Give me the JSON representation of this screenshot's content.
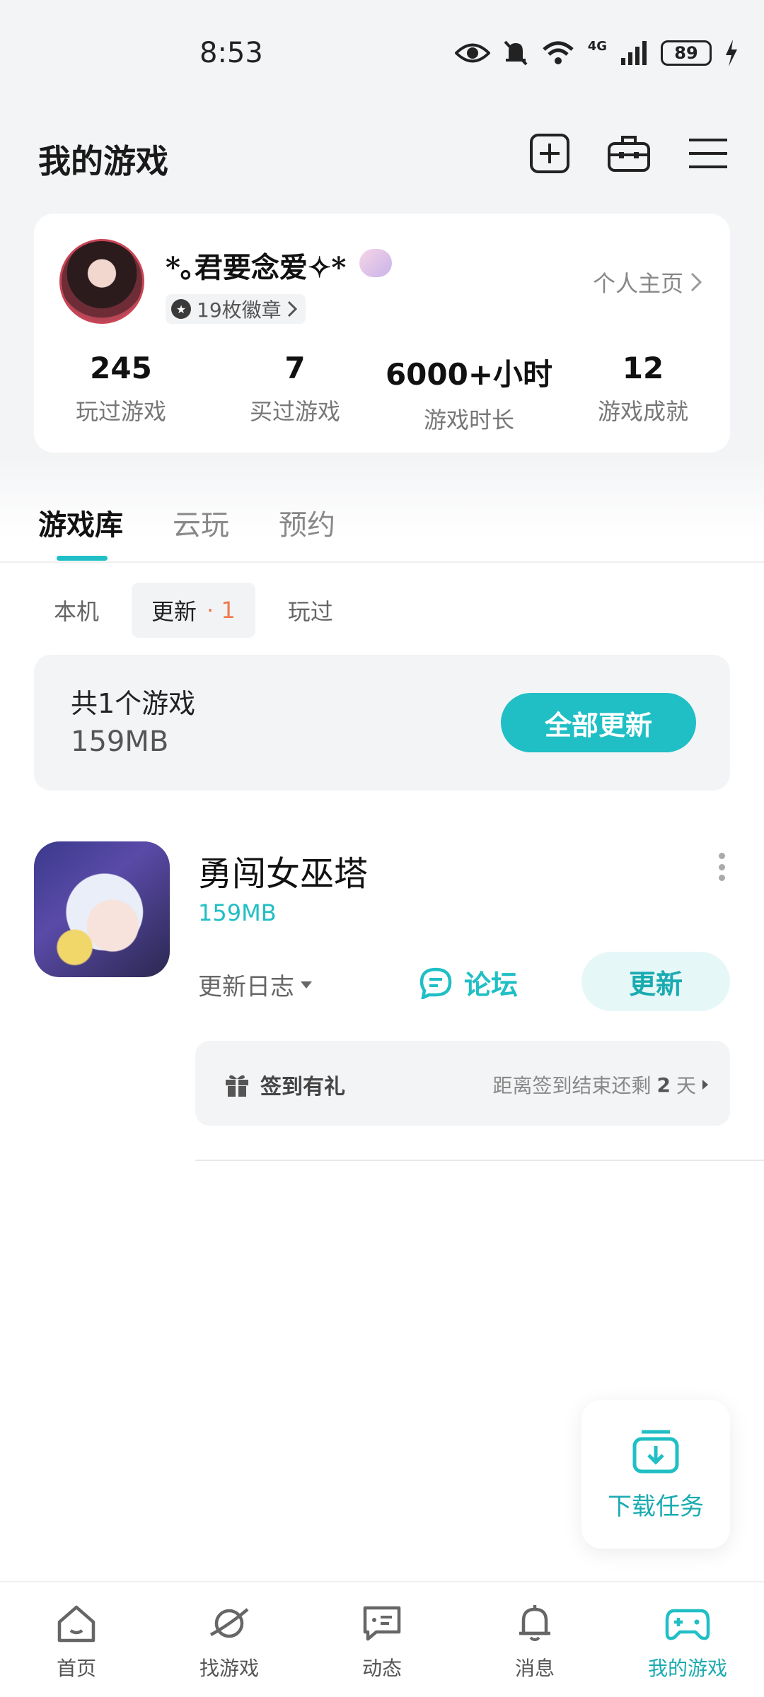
{
  "status_bar": {
    "time": "8:53",
    "network": "4G",
    "battery": "89"
  },
  "header": {
    "title": "我的游戏"
  },
  "profile": {
    "username": "*｡君要念爱✧*",
    "badges": "19枚徽章",
    "profile_link": "个人主页",
    "stats": [
      {
        "value": "245",
        "label": "玩过游戏"
      },
      {
        "value": "7",
        "label": "买过游戏"
      },
      {
        "value": "6000+小时",
        "label": "游戏时长"
      },
      {
        "value": "12",
        "label": "游戏成就"
      }
    ]
  },
  "main_tabs": [
    {
      "label": "游戏库"
    },
    {
      "label": "云玩"
    },
    {
      "label": "预约"
    }
  ],
  "sub_tabs": [
    {
      "label": "本机"
    },
    {
      "label": "更新",
      "count": "· 1"
    },
    {
      "label": "玩过"
    }
  ],
  "summary": {
    "count_text": "共1个游戏",
    "size": "159MB",
    "update_all": "全部更新"
  },
  "game": {
    "name": "勇闯女巫塔",
    "size": "159MB",
    "changelog": "更新日志",
    "forum": "论坛",
    "update": "更新",
    "signin_title": "签到有礼",
    "signin_prefix": "距离签到结束还剩",
    "signin_days": "2",
    "signin_suffix": "天"
  },
  "download_tasks": "下载任务",
  "bottom_nav": [
    {
      "label": "首页"
    },
    {
      "label": "找游戏"
    },
    {
      "label": "动态"
    },
    {
      "label": "消息"
    },
    {
      "label": "我的游戏"
    }
  ],
  "colors": {
    "accent": "#1fbfc5",
    "update_count": "#f07a4c"
  }
}
